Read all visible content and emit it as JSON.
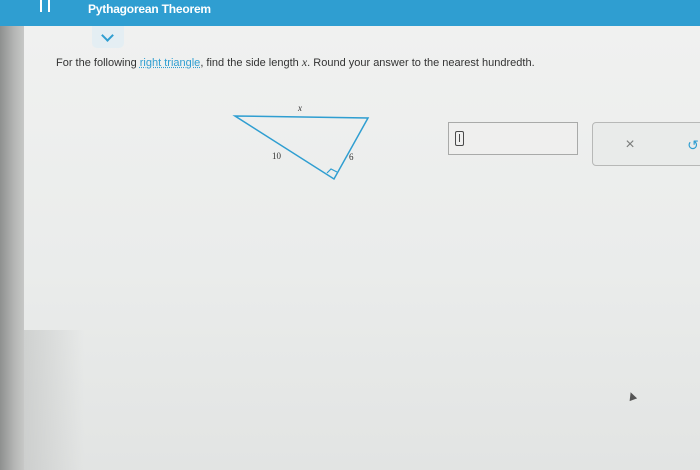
{
  "header": {
    "title": "Pythagorean Theorem"
  },
  "question": {
    "prefix": "For the following ",
    "link_text": "right triangle",
    "middle": ", find the side length ",
    "variable": "x",
    "suffix": ". Round your answer to the nearest hundredth."
  },
  "figure": {
    "label_top": "x",
    "label_left": "10",
    "label_right": "6",
    "stroke_color": "#2f9ed1"
  },
  "answer": {
    "value": ""
  },
  "actions": {
    "clear_symbol": "×",
    "undo_symbol": "↺"
  },
  "colors": {
    "accent": "#2f9ed1",
    "text": "#333333"
  }
}
